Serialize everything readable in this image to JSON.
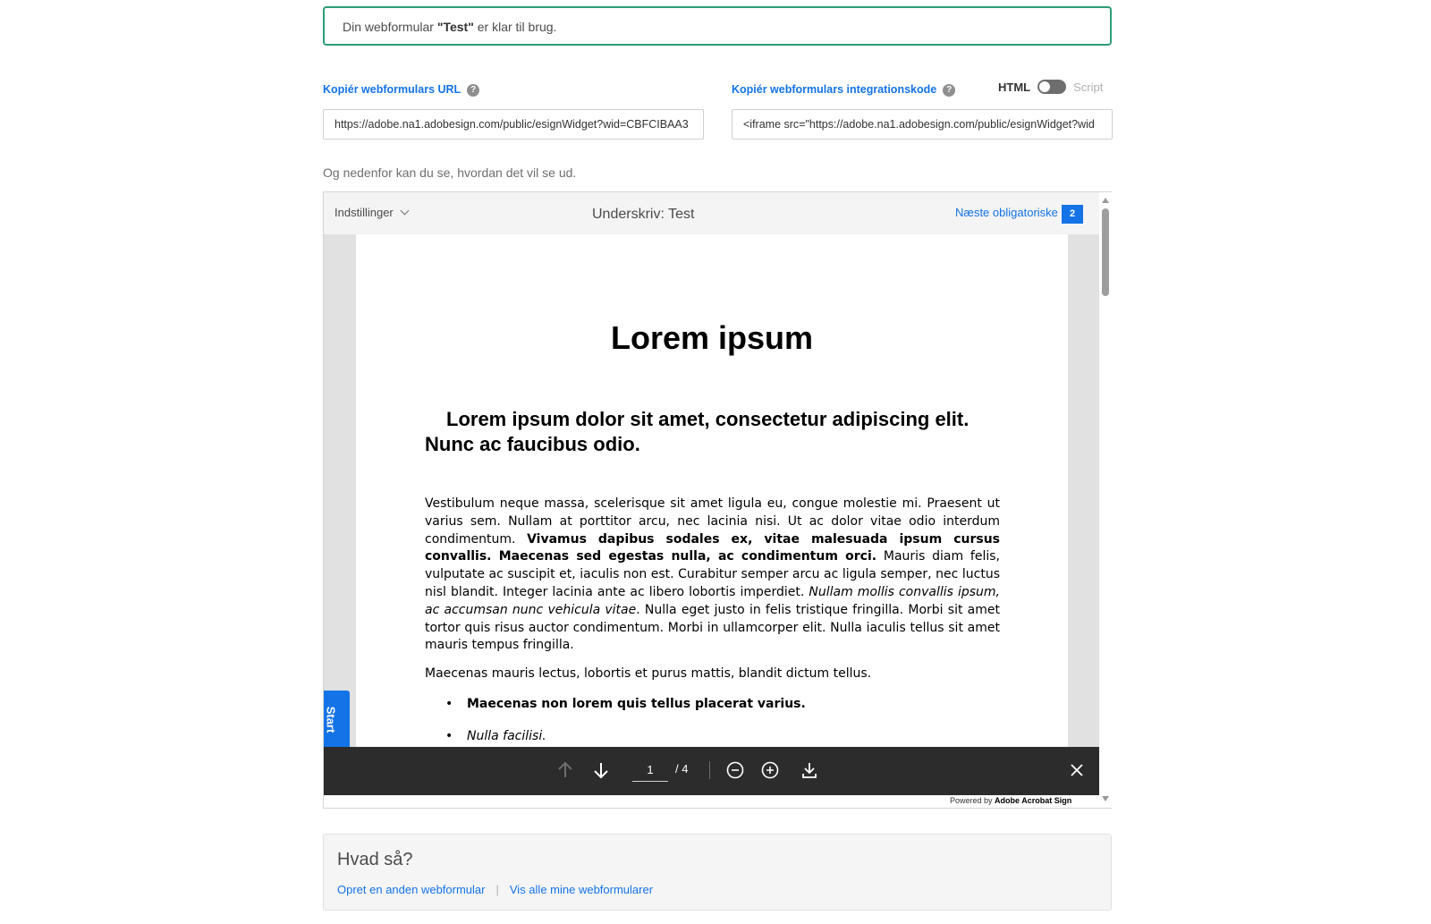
{
  "banner": {
    "prefix": "Din webformular ",
    "name": "\"Test\"",
    "suffix": " er klar til brug."
  },
  "url_section": {
    "label": "Kopiér webformulars URL",
    "value": "https://adobe.na1.adobesign.com/public/esignWidget?wid=CBFCIBAA3"
  },
  "code_section": {
    "label": "Kopiér webformulars integrationskode",
    "value": "<iframe src=\"https://adobe.na1.adobesign.com/public/esignWidget?wid"
  },
  "toggle": {
    "left": "HTML",
    "right": "Script",
    "state": "HTML"
  },
  "preview_note": "Og nedenfor kan du se, hvordan det vil se ud.",
  "viewer": {
    "settings_label": "Indstillinger",
    "title": "Underskriv: Test",
    "next_required_label": "Næste obligatoriske",
    "next_required_count": "2",
    "start_label": "Start",
    "page_current": "1",
    "page_total": "/ 4",
    "powered_by": "Powered by",
    "powered_brand": "Adobe Acrobat Sign"
  },
  "document": {
    "h1": "Lorem ipsum",
    "h2": "Lorem ipsum dolor sit amet, consectetur adipiscing elit. Nunc ac faucibus odio.",
    "para1_a": "Vestibulum neque massa, scelerisque sit amet ligula eu, congue molestie mi. Praesent ut varius sem. Nullam at porttitor arcu, nec lacinia nisi. Ut ac dolor vitae odio interdum condimentum. ",
    "para1_b": "Vivamus dapibus sodales ex, vitae malesuada ipsum cursus convallis. Maecenas sed egestas nulla, ac condimentum orci.",
    "para1_c": " Mauris diam felis, vulputate ac suscipit et, iaculis non est. Curabitur semper arcu ac ligula semper, nec luctus nisl blandit. Integer lacinia ante ac libero lobortis imperdiet. ",
    "para1_d": "Nullam mollis convallis ipsum, ac accumsan nunc vehicula vitae",
    "para1_e": ". Nulla eget justo in felis tristique fringilla. Morbi sit amet tortor quis risus auctor condimentum. Morbi in ullamcorper elit. Nulla iaculis tellus sit amet mauris tempus fringilla.",
    "para2": "Maecenas mauris lectus, lobortis et purus mattis, blandit dictum tellus.",
    "list": [
      "Maecenas non lorem quis tellus placerat varius.",
      "Nulla facilisi."
    ]
  },
  "next_steps": {
    "title": "Hvad så?",
    "link1": "Opret en anden webformular",
    "separator": "|",
    "link2": "Vis alle mine webformularer"
  },
  "colors": {
    "accent": "#1473e6",
    "success_border": "#2d9d78",
    "toolbar": "#2c2c2c"
  }
}
